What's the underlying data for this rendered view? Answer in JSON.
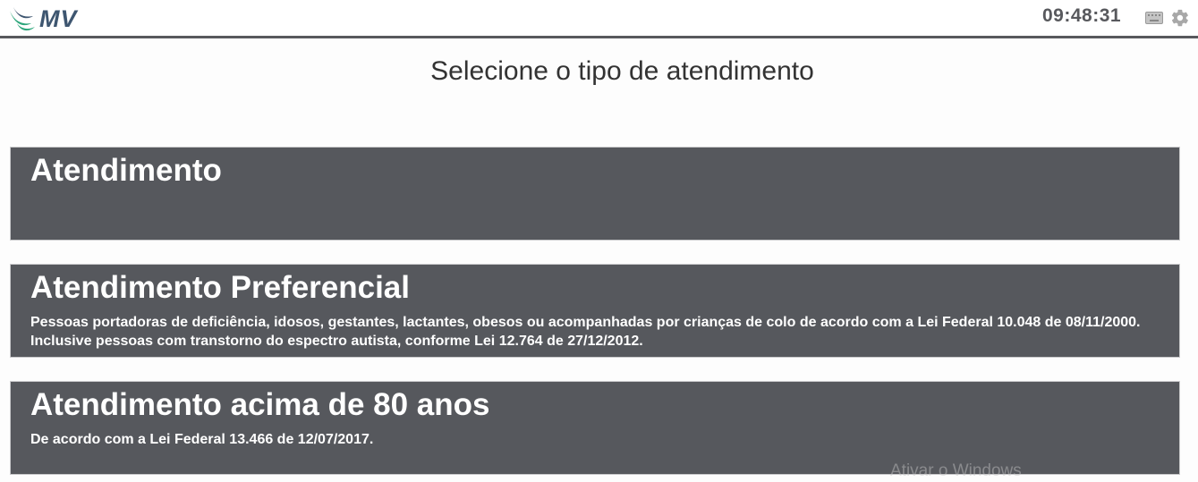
{
  "header": {
    "logo_text": "MV",
    "clock": "09:48:31",
    "icons": {
      "keyboard": "keyboard-icon",
      "settings": "gear-icon"
    }
  },
  "main": {
    "title": "Selecione o tipo de atendimento",
    "options": [
      {
        "title": "Atendimento",
        "description": ""
      },
      {
        "title": "Atendimento Preferencial",
        "description": "Pessoas portadoras de deficiência, idosos, gestantes, lactantes, obesos ou acompanhadas por crianças de colo de acordo com a Lei Federal 10.048 de 08/11/2000. Inclusive pessoas com transtorno do espectro autista, conforme Lei 12.764 de 27/12/2012."
      },
      {
        "title": "Atendimento acima de 80 anos",
        "description": "De acordo com a Lei Federal 13.466 de 12/07/2017."
      }
    ]
  },
  "overlay": {
    "watermark": "Ativar o Windows"
  },
  "colors": {
    "option_bg": "#56585d",
    "logo_blue": "#3e5670",
    "logo_green": "#2ba57a"
  }
}
